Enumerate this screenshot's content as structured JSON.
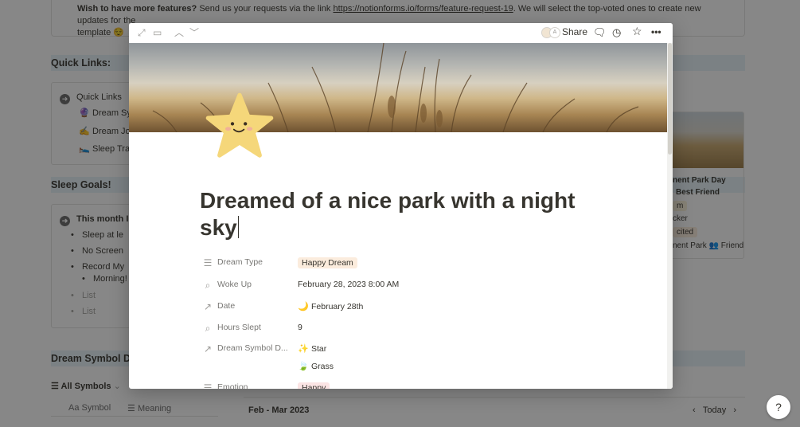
{
  "background": {
    "callout": {
      "bold": "Wish to have more features?",
      "text1": " Send us your requests via the link ",
      "link": "https://notionforms.io/forms/feature-request-19",
      "text2": ". We will select the top-voted ones to create new updates for the",
      "text3": "template",
      "emoji": "😌"
    },
    "quick_links_heading": "Quick Links:",
    "quick_links": {
      "title": "Quick Links",
      "items": [
        {
          "emoji": "🔮",
          "label": "Dream Sy"
        },
        {
          "emoji": "✍️",
          "label": "Dream Jo"
        },
        {
          "emoji": "🛌",
          "label": "Sleep Trac"
        }
      ]
    },
    "sleep_goals_heading": "Sleep Goals!",
    "sleep_goals": {
      "title": "This month I w",
      "bullets": [
        "Sleep at le",
        "No Screen",
        "Record My",
        "Morning!"
      ],
      "placeholders": [
        "List",
        "List"
      ]
    },
    "card": {
      "line1": "nent Park Day",
      "line2": "Best Friend",
      "tag1": "m",
      "line3": "cker",
      "tag2": "cited",
      "line4": "nent Park 👥 Friends"
    },
    "dream_symbol_heading": "Dream Symbol D",
    "views": {
      "all_symbols": "All Symbols",
      "columns": [
        "Aa Symbol",
        "Meaning"
      ],
      "month": "Feb - Mar 2023",
      "today": "Today",
      "help": "?"
    }
  },
  "modal": {
    "toolbar": {
      "share": "Share"
    },
    "title": "Dreamed of a nice park with a night sky",
    "properties": [
      {
        "icon": "list-icon",
        "glyph": "☰",
        "label": "Dream Type",
        "value": "Happy Dream",
        "kind": "tag",
        "color": "#fbecdd"
      },
      {
        "icon": "search-icon",
        "glyph": "⌕",
        "label": "Woke Up",
        "value": "February 28, 2023 8:00 AM",
        "kind": "text"
      },
      {
        "icon": "arrow-up-right-icon",
        "glyph": "↗",
        "label": "Date",
        "value": "February 28th",
        "emoji": "🌙",
        "kind": "emoji"
      },
      {
        "icon": "search-icon",
        "glyph": "⌕",
        "label": "Hours Slept",
        "value": "9",
        "kind": "text"
      },
      {
        "icon": "arrow-up-right-icon",
        "glyph": "↗",
        "label": "Dream Symbol D...",
        "value": "Star",
        "emoji": "✨",
        "kind": "emoji"
      },
      {
        "icon": "list-icon",
        "glyph": "☰",
        "label": "Emotion",
        "value": "Happy",
        "kind": "tag",
        "color": "#fbe4e4"
      }
    ],
    "extra_value": {
      "emoji": "🍃",
      "value": "Grass"
    }
  }
}
